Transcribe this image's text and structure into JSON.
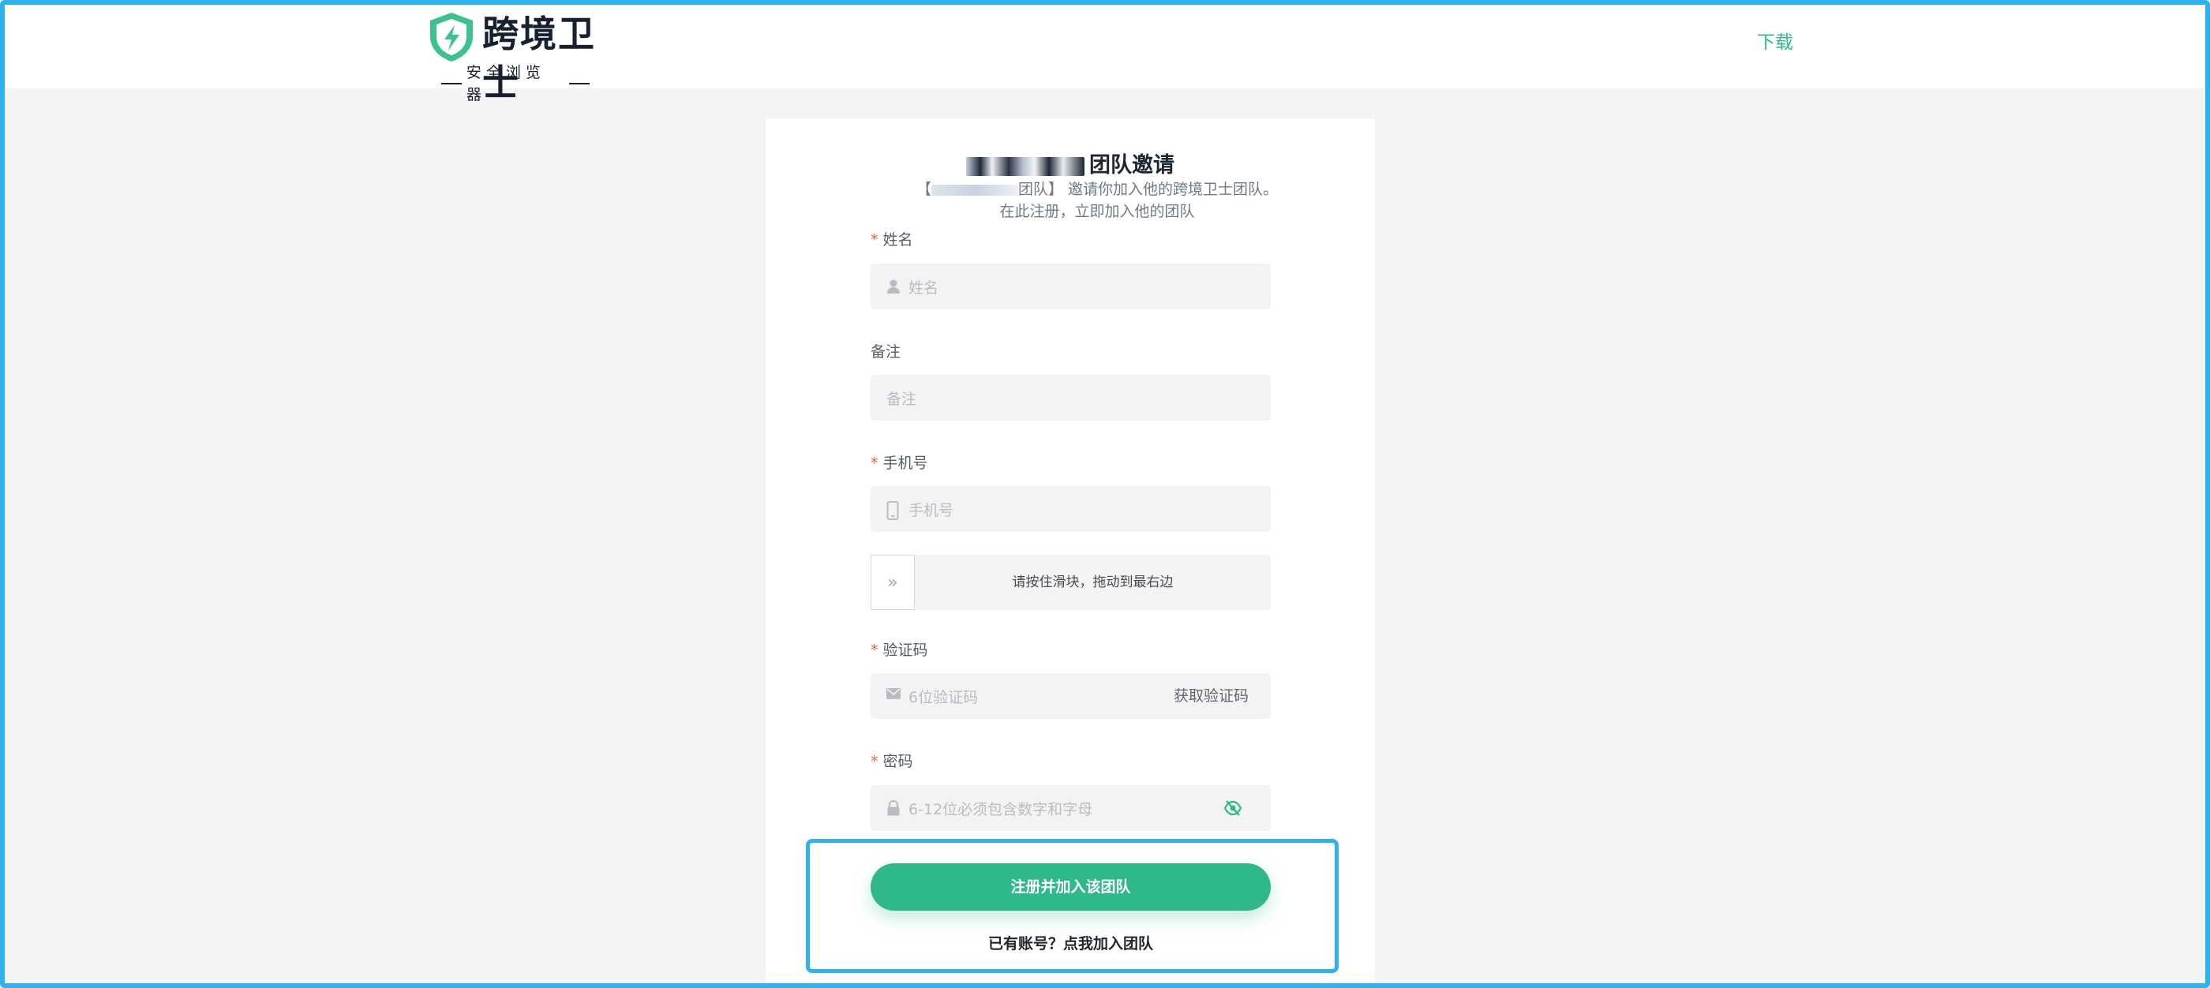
{
  "header": {
    "logo_title": "跨境卫士",
    "logo_subtitle": "安全浏览器",
    "download_label": "下载"
  },
  "invite": {
    "title_suffix": "团队邀请",
    "description_line1_prefix": "【",
    "description_line1_suffix": "团队】 邀请你加入他的跨境卫士团队。",
    "description_line2": "在此注册，立即加入他的团队"
  },
  "form": {
    "name": {
      "label": "姓名",
      "required": "*",
      "placeholder": "姓名",
      "icon": "user-icon"
    },
    "remark": {
      "label": "备注",
      "placeholder": "备注"
    },
    "phone": {
      "label": "手机号",
      "required": "*",
      "placeholder": "手机号",
      "icon": "phone-icon"
    },
    "slider": {
      "text": "请按住滑块，拖动到最右边",
      "handle_glyph": "»"
    },
    "code": {
      "label": "验证码",
      "required": "*",
      "placeholder": "6位验证码",
      "icon": "mail-icon",
      "get_code_label": "获取验证码"
    },
    "password": {
      "label": "密码",
      "required": "*",
      "placeholder": "6-12位必须包含数字和字母",
      "icon": "lock-icon",
      "toggle_icon": "eye-off-icon"
    }
  },
  "actions": {
    "submit_label": "注册并加入该团队",
    "login_link": "已有账号？点我加入团队"
  },
  "colors": {
    "brand": "#2fb88c",
    "highlight": "#2db2ee",
    "required": "#f25a3c"
  }
}
